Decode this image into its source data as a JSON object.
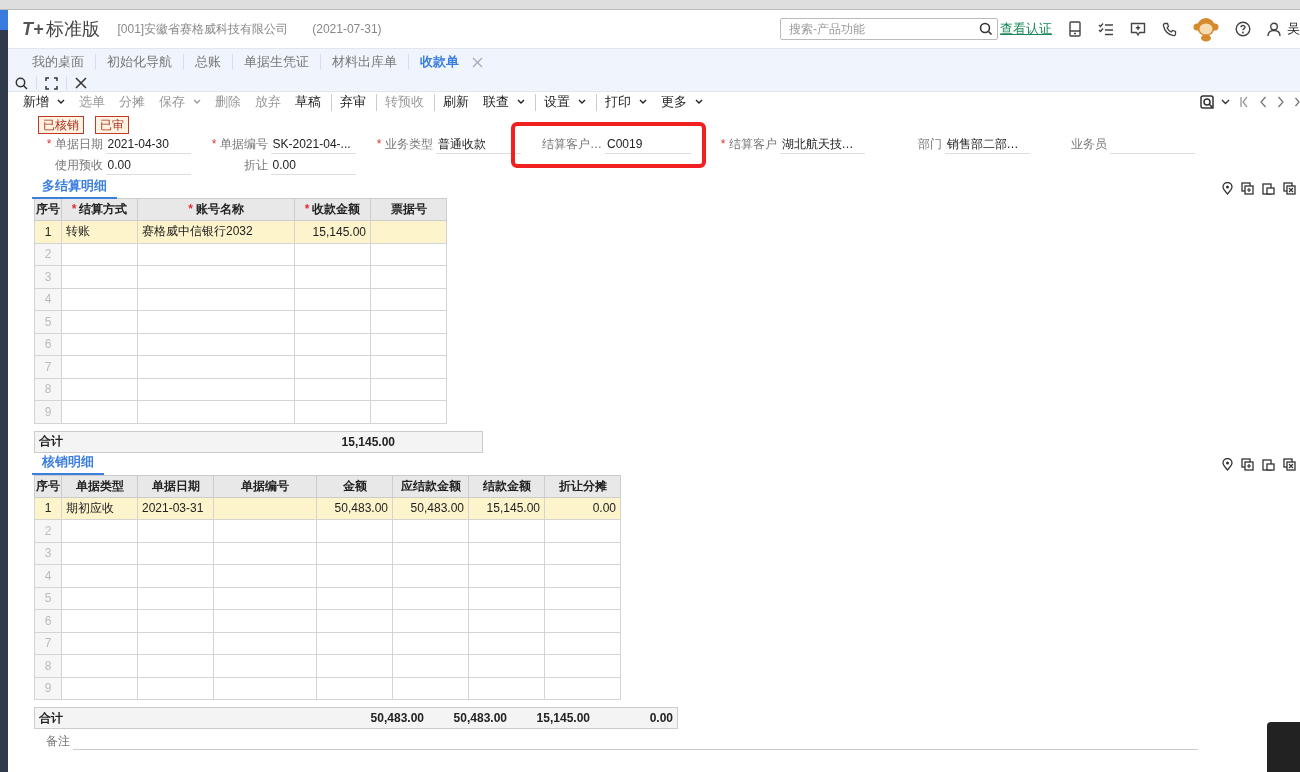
{
  "header": {
    "logo_mark": "T+",
    "product": "标准版",
    "company": "[001]安徽省赛格威科技有限公司",
    "date": "(2021-07-31)",
    "search": {
      "placeholder": "搜索-产品功能"
    },
    "link": "查看认证",
    "user": "吴"
  },
  "tabs": [
    {
      "label": "我的桌面",
      "selected": false
    },
    {
      "label": "初始化导航",
      "selected": false
    },
    {
      "label": "总账",
      "selected": false
    },
    {
      "label": "单据生凭证",
      "selected": false
    },
    {
      "label": "材料出库单",
      "selected": false
    },
    {
      "label": "收款单",
      "selected": true
    }
  ],
  "toolbar": [
    {
      "label": "新增",
      "disabled": false,
      "dropdown": true,
      "divider": false
    },
    {
      "label": "选单",
      "disabled": true,
      "dropdown": false,
      "divider": false
    },
    {
      "label": "分摊",
      "disabled": true,
      "dropdown": false,
      "divider": false
    },
    {
      "label": "保存",
      "disabled": true,
      "dropdown": true,
      "divider": false
    },
    {
      "label": "删除",
      "disabled": true,
      "dropdown": false,
      "divider": false
    },
    {
      "label": "放弃",
      "disabled": true,
      "dropdown": false,
      "divider": false
    },
    {
      "label": "草稿",
      "disabled": false,
      "dropdown": false,
      "divider": false
    },
    {
      "label": "弃审",
      "disabled": false,
      "dropdown": false,
      "divider": true
    },
    {
      "label": "转预收",
      "disabled": true,
      "dropdown": false,
      "divider": true
    },
    {
      "label": "刷新",
      "disabled": false,
      "dropdown": false,
      "divider": true
    },
    {
      "label": "联查",
      "disabled": false,
      "dropdown": true,
      "divider": false
    },
    {
      "label": "设置",
      "disabled": false,
      "dropdown": true,
      "divider": true
    },
    {
      "label": "打印",
      "disabled": false,
      "dropdown": true,
      "divider": true
    },
    {
      "label": "更多",
      "disabled": false,
      "dropdown": true,
      "divider": false
    }
  ],
  "badges": [
    "已核销",
    "已审"
  ],
  "form_rows": [
    [
      {
        "required_mark": "*",
        "label": "单据日期",
        "value": "2021-04-30",
        "highlighted": false
      },
      {
        "required_mark": "*",
        "label": "单据编号",
        "value": "SK-2021-04-...",
        "highlighted": false
      },
      {
        "required_mark": "*",
        "label": "业务类型",
        "value": "普通收款",
        "highlighted": false
      },
      {
        "label": "结算客户…",
        "value": "C0019",
        "highlighted": true
      },
      {
        "required_mark": "*",
        "label": "结算客户",
        "value": "湖北航天技…",
        "highlighted": false
      },
      {
        "label": "部门",
        "value": "销售部二部…",
        "highlighted": false
      },
      {
        "label": "业务员",
        "highlighted": false
      }
    ],
    [
      {
        "label": "使用预收",
        "value": "0.00",
        "highlighted": false
      },
      {
        "label": "折让",
        "value": "0.00",
        "highlighted": false
      }
    ]
  ],
  "sections": [
    {
      "title": "多结算明细",
      "columns": [
        {
          "label": "序号"
        },
        {
          "required_mark": "*",
          "label": "结算方式"
        },
        {
          "required_mark": "*",
          "label": "账号名称"
        },
        {
          "required_mark": "*",
          "label": "收款金额"
        },
        {
          "label": "票据号"
        }
      ],
      "rows": [
        {
          "no": "1",
          "selected": true,
          "cells": [
            "转账",
            "赛格威中信银行2032",
            "15,145.00"
          ]
        },
        {
          "no": "2",
          "selected": false
        },
        {
          "no": "3",
          "selected": false
        },
        {
          "no": "4",
          "selected": false
        },
        {
          "no": "5",
          "selected": false
        },
        {
          "no": "6",
          "selected": false
        },
        {
          "no": "7",
          "selected": false
        },
        {
          "no": "8",
          "selected": false
        },
        {
          "no": "9",
          "selected": false
        }
      ],
      "total": {
        "label": "合计",
        "values": [
          "15,145.00"
        ]
      }
    },
    {
      "title": "核销明细",
      "columns": [
        {
          "label": "序号"
        },
        {
          "label": "单据类型"
        },
        {
          "label": "单据日期"
        },
        {
          "label": "单据编号"
        },
        {
          "label": "金额"
        },
        {
          "label": "应结款金额"
        },
        {
          "label": "结款金额"
        },
        {
          "label": "折让分摊"
        }
      ],
      "rows": [
        {
          "no": "1",
          "selected": true,
          "cells": [
            "期初应收",
            "2021-03-31",
            null,
            "50,483.00",
            "50,483.00",
            "15,145.00",
            "0.00"
          ]
        },
        {
          "no": "2",
          "selected": false
        },
        {
          "no": "3",
          "selected": false
        },
        {
          "no": "4",
          "selected": false
        },
        {
          "no": "5",
          "selected": false
        },
        {
          "no": "6",
          "selected": false
        },
        {
          "no": "7",
          "selected": false
        },
        {
          "no": "8",
          "selected": false
        },
        {
          "no": "9",
          "selected": false
        }
      ],
      "total": {
        "label": "合计",
        "values": [
          "50,483.00",
          "50,483.00",
          "15,145.00",
          "0.00"
        ]
      }
    }
  ],
  "remark": {
    "label": "备注"
  }
}
